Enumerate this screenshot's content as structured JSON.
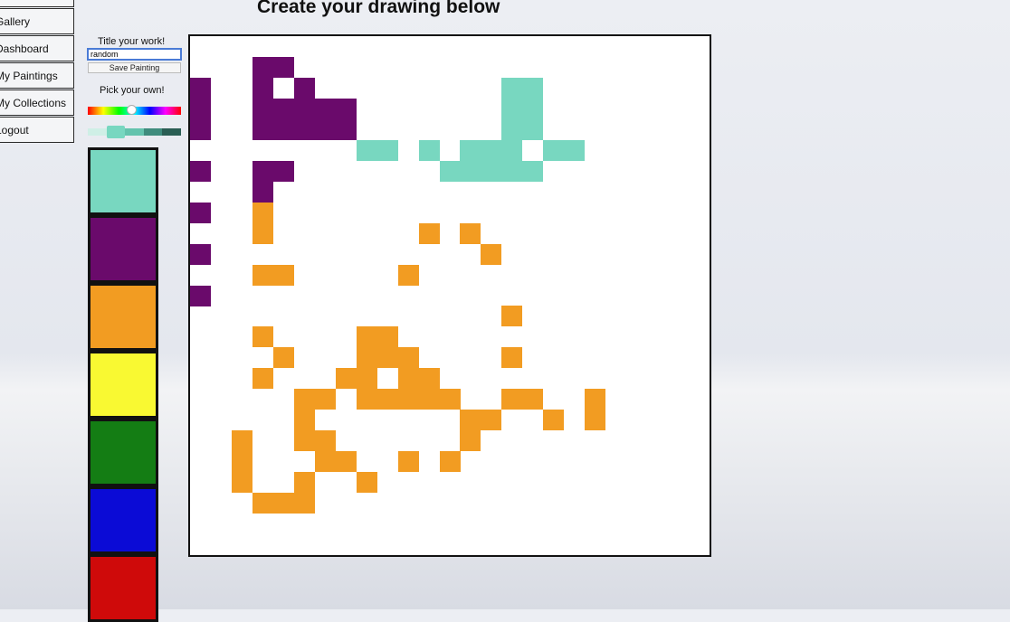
{
  "nav": {
    "items": [
      {
        "label": "Gallery",
        "id": "gallery"
      },
      {
        "label": "Dashboard",
        "id": "dashboard"
      },
      {
        "label": "My Paintings",
        "id": "my-paintings"
      },
      {
        "label": "My Collections",
        "id": "my-collections"
      },
      {
        "label": "Logout",
        "id": "logout"
      }
    ]
  },
  "page": {
    "title": "Create your drawing below"
  },
  "form": {
    "title_label": "Title your work!",
    "title_value": "random",
    "save_label": "Save Painting"
  },
  "picker": {
    "label": "Pick your own!",
    "hue_position": 0.47,
    "shades": [
      "#cfefe6",
      "#78d7c0",
      "#64c3ad",
      "#3f8c7d",
      "#2a5e54"
    ],
    "selected_shade": 1
  },
  "palette": [
    "#78d7c0",
    "#6a0a6b",
    "#f29c22",
    "#f9f932",
    "#147d14",
    "#0b0bd6",
    "#cf0a0a"
  ],
  "canvas": {
    "grid": 25,
    "background": "#ffffff",
    "colors": {
      "teal": "#78d7c0",
      "purple": "#6a0a6b",
      "orange": "#f29c22"
    },
    "cells": {
      "purple": [
        [
          0,
          2
        ],
        [
          0,
          3
        ],
        [
          0,
          4
        ],
        [
          0,
          6
        ],
        [
          0,
          8
        ],
        [
          0,
          10
        ],
        [
          0,
          12
        ],
        [
          3,
          1
        ],
        [
          4,
          1
        ],
        [
          3,
          2
        ],
        [
          5,
          2
        ],
        [
          3,
          3
        ],
        [
          4,
          3
        ],
        [
          5,
          3
        ],
        [
          6,
          3
        ],
        [
          7,
          3
        ],
        [
          3,
          4
        ],
        [
          4,
          4
        ],
        [
          5,
          4
        ],
        [
          6,
          4
        ],
        [
          7,
          4
        ],
        [
          3,
          6
        ],
        [
          4,
          6
        ],
        [
          3,
          7
        ]
      ],
      "teal": [
        [
          15,
          2
        ],
        [
          16,
          2
        ],
        [
          15,
          3
        ],
        [
          16,
          3
        ],
        [
          15,
          4
        ],
        [
          16,
          4
        ],
        [
          8,
          5
        ],
        [
          9,
          5
        ],
        [
          11,
          5
        ],
        [
          13,
          5
        ],
        [
          14,
          5
        ],
        [
          15,
          5
        ],
        [
          17,
          5
        ],
        [
          18,
          5
        ],
        [
          12,
          6
        ],
        [
          13,
          6
        ],
        [
          14,
          6
        ],
        [
          15,
          6
        ],
        [
          16,
          6
        ]
      ],
      "orange": [
        [
          3,
          8
        ],
        [
          3,
          9
        ],
        [
          11,
          9
        ],
        [
          13,
          9
        ],
        [
          14,
          10
        ],
        [
          3,
          11
        ],
        [
          4,
          11
        ],
        [
          10,
          11
        ],
        [
          15,
          13
        ],
        [
          3,
          14
        ],
        [
          8,
          14
        ],
        [
          9,
          14
        ],
        [
          4,
          15
        ],
        [
          8,
          15
        ],
        [
          9,
          15
        ],
        [
          10,
          15
        ],
        [
          15,
          15
        ],
        [
          3,
          16
        ],
        [
          7,
          16
        ],
        [
          8,
          16
        ],
        [
          10,
          16
        ],
        [
          11,
          16
        ],
        [
          5,
          17
        ],
        [
          6,
          17
        ],
        [
          8,
          17
        ],
        [
          9,
          17
        ],
        [
          10,
          17
        ],
        [
          11,
          17
        ],
        [
          12,
          17
        ],
        [
          15,
          17
        ],
        [
          16,
          17
        ],
        [
          19,
          17
        ],
        [
          5,
          18
        ],
        [
          13,
          18
        ],
        [
          14,
          18
        ],
        [
          17,
          18
        ],
        [
          19,
          18
        ],
        [
          2,
          19
        ],
        [
          5,
          19
        ],
        [
          6,
          19
        ],
        [
          13,
          19
        ],
        [
          2,
          20
        ],
        [
          6,
          20
        ],
        [
          7,
          20
        ],
        [
          10,
          20
        ],
        [
          12,
          20
        ],
        [
          2,
          21
        ],
        [
          5,
          21
        ],
        [
          8,
          21
        ],
        [
          3,
          22
        ],
        [
          4,
          22
        ],
        [
          5,
          22
        ]
      ]
    }
  }
}
